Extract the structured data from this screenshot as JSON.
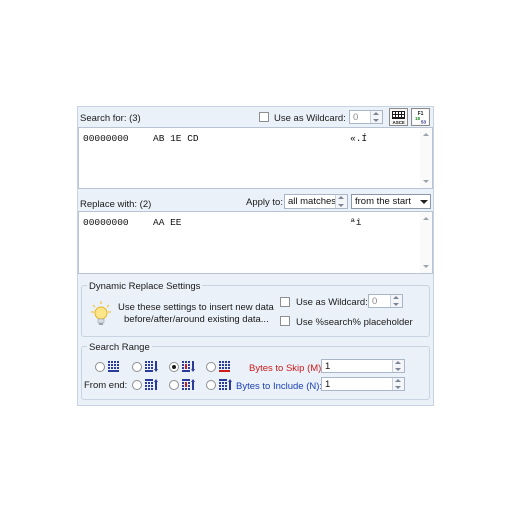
{
  "search": {
    "label": "Search for: (3)",
    "wildcard_label": "Use as Wildcard:",
    "wildcard_value": "0",
    "line_offset": "00000000",
    "line_hex": "AB 1E CD",
    "line_text": "«.Í"
  },
  "replace": {
    "label": "Replace with: (2)",
    "apply_to_label": "Apply to:",
    "apply_to_value": "all matches",
    "direction_value": "from the start",
    "line_offset": "00000000",
    "line_hex": "AA EE",
    "line_text": "ªî"
  },
  "dynamic": {
    "title": "Dynamic Replace Settings",
    "desc_line1": "Use these settings to insert new data",
    "desc_line2": "before/after/around existing data...",
    "wildcard_label": "Use as Wildcard:",
    "wildcard_value": "0",
    "placeholder_label": "Use %search% placeholder"
  },
  "range": {
    "title": "Search Range",
    "from_end_label": "From end:",
    "skip_label": "Bytes to Skip (M):",
    "skip_value": "1",
    "include_label": "Bytes to Include (N):",
    "include_value": "1"
  },
  "icons": {
    "ascii": "ASCII",
    "f1": "F1",
    "b1": "18",
    "f2": "53"
  }
}
